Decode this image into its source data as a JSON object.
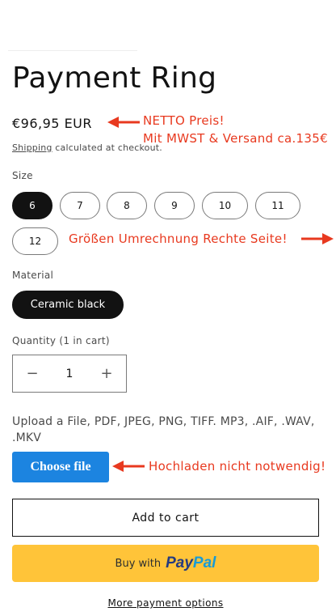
{
  "product": {
    "title": "Payment Ring",
    "price": "€96,95 EUR",
    "shipping_link": "Shipping",
    "shipping_rest": " calculated at checkout."
  },
  "size": {
    "label": "Size",
    "options": [
      "6",
      "7",
      "8",
      "9",
      "10",
      "11",
      "12"
    ],
    "selected": "6"
  },
  "material": {
    "label": "Material",
    "selected": "Ceramic black"
  },
  "quantity": {
    "label": "Quantity (1 in cart)",
    "value": "1",
    "minus": "−",
    "plus": "+"
  },
  "upload": {
    "label": "Upload a File, PDF, JPEG, PNG, TIFF. MP3, .AIF, .WAV, .MKV",
    "button": "Choose file"
  },
  "actions": {
    "add_to_cart": "Add to cart",
    "buy_with": "Buy with",
    "paypal_pay": "Pay",
    "paypal_pal": "Pal",
    "more_options": "More payment options"
  },
  "annotations": {
    "netto_line1": "NETTO Preis!",
    "netto_line2": "Mit MWST & Versand ca.135€",
    "size_conversion": "Größen Umrechnung Rechte Seite!",
    "upload_note": "Hochladen nicht notwendig!"
  },
  "colors": {
    "annotation": "#e8391f",
    "choose_file": "#1c84e0",
    "paypal": "#ffc439"
  }
}
